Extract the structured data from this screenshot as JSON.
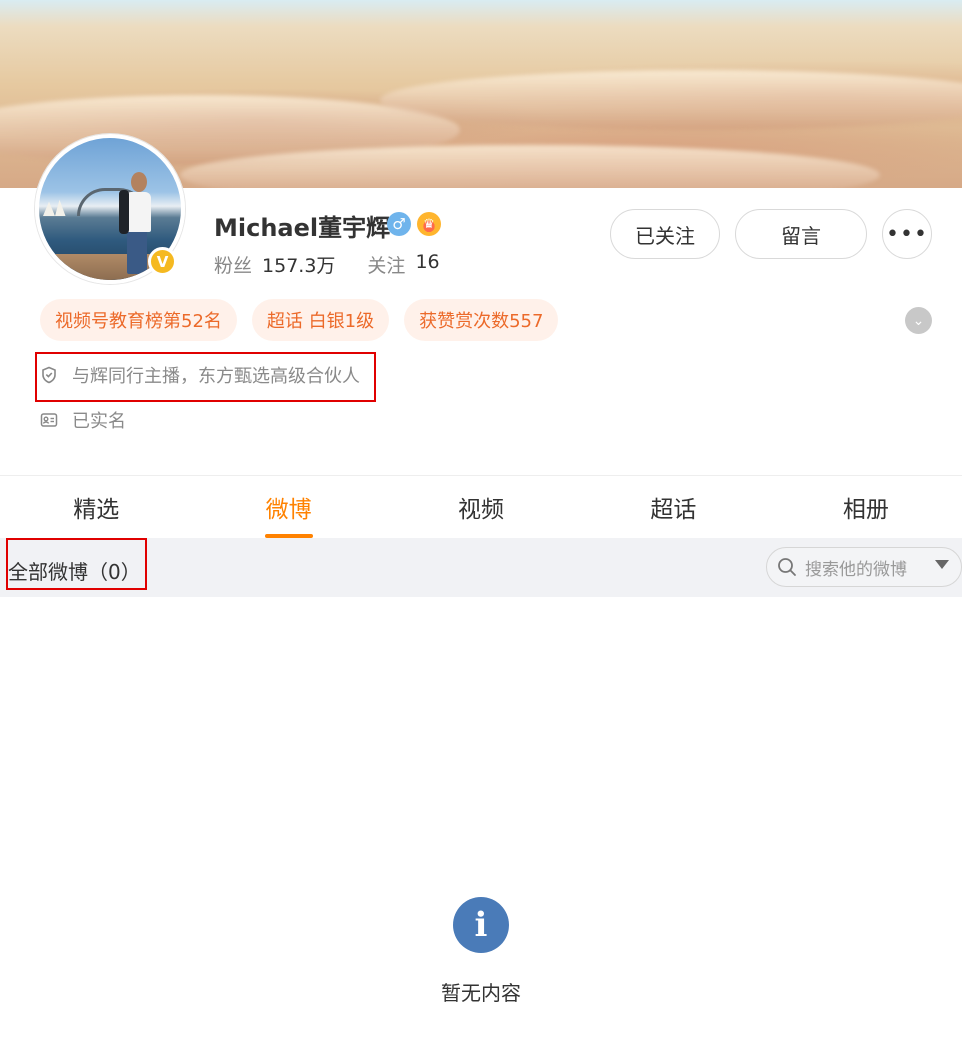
{
  "profile": {
    "username": "Michael董宇辉",
    "gender_symbol": "♂",
    "verified_symbol": "V",
    "stats": {
      "followers_label": "粉丝",
      "followers_value": "157.3万",
      "following_label": "关注",
      "following_value": "16"
    },
    "actions": {
      "follow_label": "已关注",
      "message_label": "留言",
      "more_label": "•••"
    },
    "tags": [
      "视频号教育榜第52名",
      "超话 白银1级",
      "获赞赏次数557"
    ],
    "bio": "与辉同行主播，东方甄选高级合伙人",
    "realname": "已实名"
  },
  "tabs": [
    "精选",
    "微博",
    "视频",
    "超话",
    "相册"
  ],
  "active_tab": "微博",
  "feed": {
    "all_label": "全部微博（0）",
    "search_placeholder": "搜索他的微博",
    "empty_text": "暂无内容"
  },
  "colors": {
    "accent": "#ff8200",
    "tag_text": "#ec6a2a",
    "tag_bg": "#fff1ea",
    "verify_badge": "#f5b921",
    "info_icon": "#4a7bb8",
    "highlight_box": "#e00000"
  }
}
